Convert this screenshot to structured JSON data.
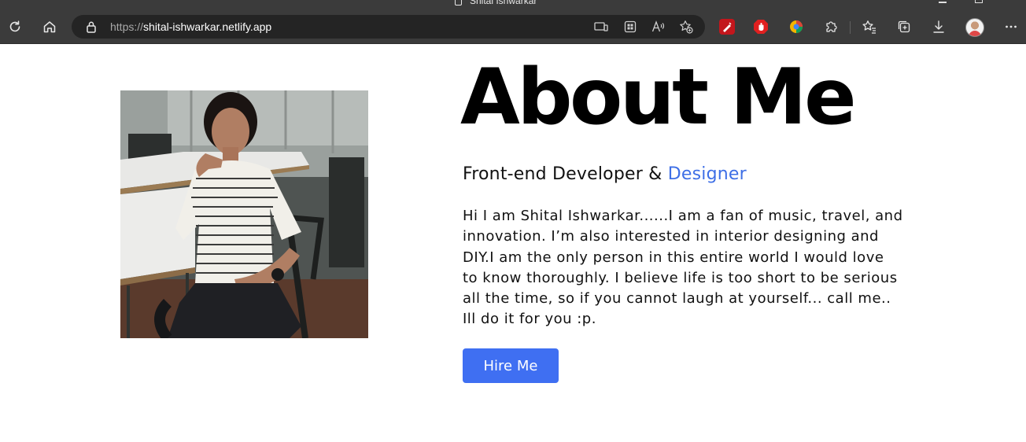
{
  "browser": {
    "tab_title": "Shital Ishwarkar",
    "url_scheme": "https://",
    "url_host": "shital-ishwarkar.netlify.app"
  },
  "page": {
    "title": "About Me",
    "role_prefix": "Front-end Developer & ",
    "role_accent": "Designer",
    "bio": "Hi I am Shital Ishwarkar......I am a fan of music, travel, and innovation. I’m also interested in interior designing and DIY.I am the only person in this entire world I would love to know thoroughly. I believe life is too short to be serious all the time, so if you cannot laugh at yourself... call me.. Ill do it for you :p.",
    "hire_button": "Hire Me"
  },
  "colors": {
    "accent": "#3e6fe6",
    "button": "#3f6ff2",
    "chrome": "#3b3b3b"
  },
  "icons": [
    "refresh-icon",
    "home-icon",
    "lock-icon",
    "tablet-icon",
    "apps-icon",
    "read-aloud-icon",
    "favorite-add-icon",
    "extension-icon",
    "favorites-icon",
    "collections-icon",
    "download-icon",
    "more-icon"
  ]
}
